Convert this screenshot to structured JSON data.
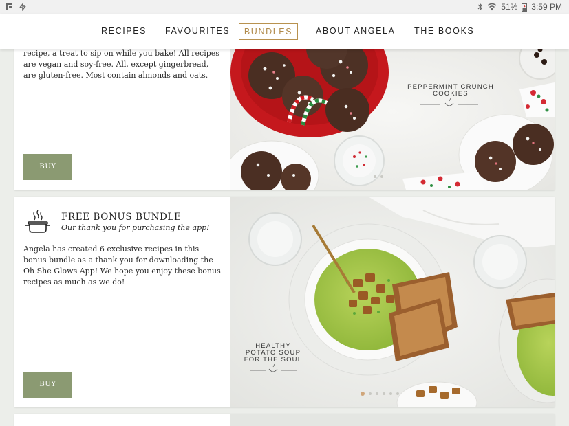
{
  "status_bar": {
    "battery": "51%",
    "time": "3:59 PM"
  },
  "nav": {
    "items": [
      {
        "label": "RECIPES"
      },
      {
        "label": "FAVOURITES"
      },
      {
        "label": "BUNDLES",
        "active": true
      },
      {
        "label": "ABOUT ANGELA"
      },
      {
        "label": "THE BOOKS"
      }
    ]
  },
  "cards": [
    {
      "description": "recipe, a treat to sip on while you bake! All recipes are vegan and soy-free. All, except gingerbread, are gluten-free. Most contain almonds and oats.",
      "buy_label": "BUY",
      "image_caption_line1": "PEPPERMINT CRUNCH",
      "image_caption_line2": "COOKIES"
    },
    {
      "title": "FREE BONUS BUNDLE",
      "subtitle": "Our thank you for purchasing the app!",
      "description": "Angela has created 6 exclusive recipes in this bonus bundle as a thank you for downloading the Oh She Glows App! We hope you enjoy these bonus recipes as much as we do!",
      "buy_label": "BUY",
      "image_caption_line1": "HEALTHY",
      "image_caption_line2": "POTATO SOUP",
      "image_caption_line3": "FOR THE SOUL",
      "carousel_dots": 6,
      "active_dot": 0
    }
  ],
  "colors": {
    "accent": "#b8924f",
    "buy_button": "#8b9a72",
    "background": "#eceeea"
  }
}
